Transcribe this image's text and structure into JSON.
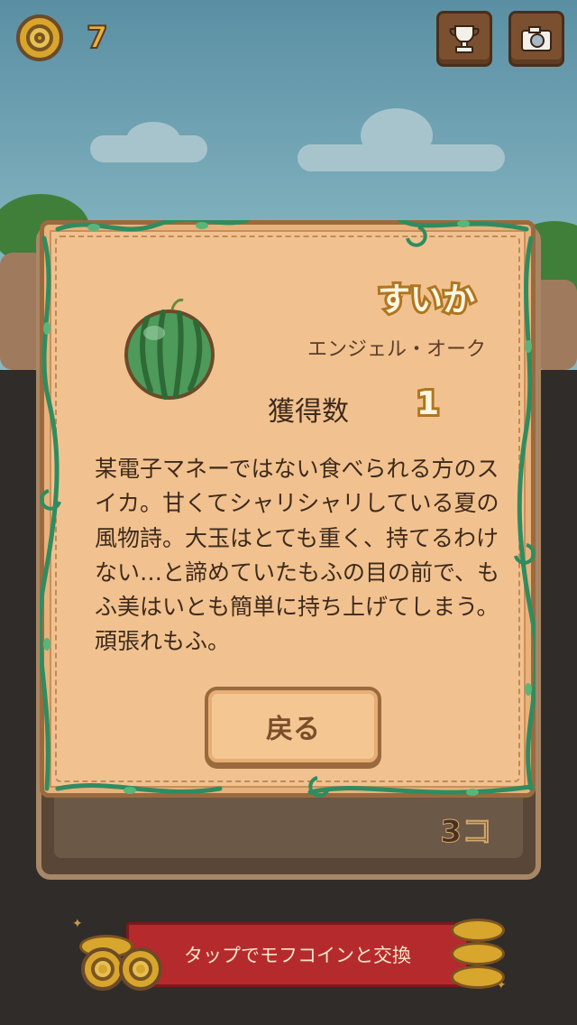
{
  "hud": {
    "coin_count": "7",
    "trophy_icon": "trophy-icon",
    "camera_icon": "camera-icon"
  },
  "card": {
    "item_name": "すいか",
    "origin": "エンジェル・オーク",
    "count_label": "獲得数",
    "count_value": "1",
    "description": "某電子マネーではない食べられる方のスイカ。甘くてシャリシャリしている夏の風物詩。大玉はとても重く、持てるわけない…と諦めていたもふの目の前で、もふ美はいとも簡単に持ち上げてしまう。頑張れもふ。",
    "back_label": "戻る",
    "item_icon": "watermelon-icon"
  },
  "shelf": {
    "count_text": "3コ"
  },
  "exchange": {
    "label": "タップでモフコインと交換"
  },
  "colors": {
    "card_bg": "#f1c28f",
    "card_border": "#9a6a3e",
    "vine": "#3c9a6a",
    "banner_red": "#b52a2d",
    "coin_gold": "#d8a52d"
  }
}
